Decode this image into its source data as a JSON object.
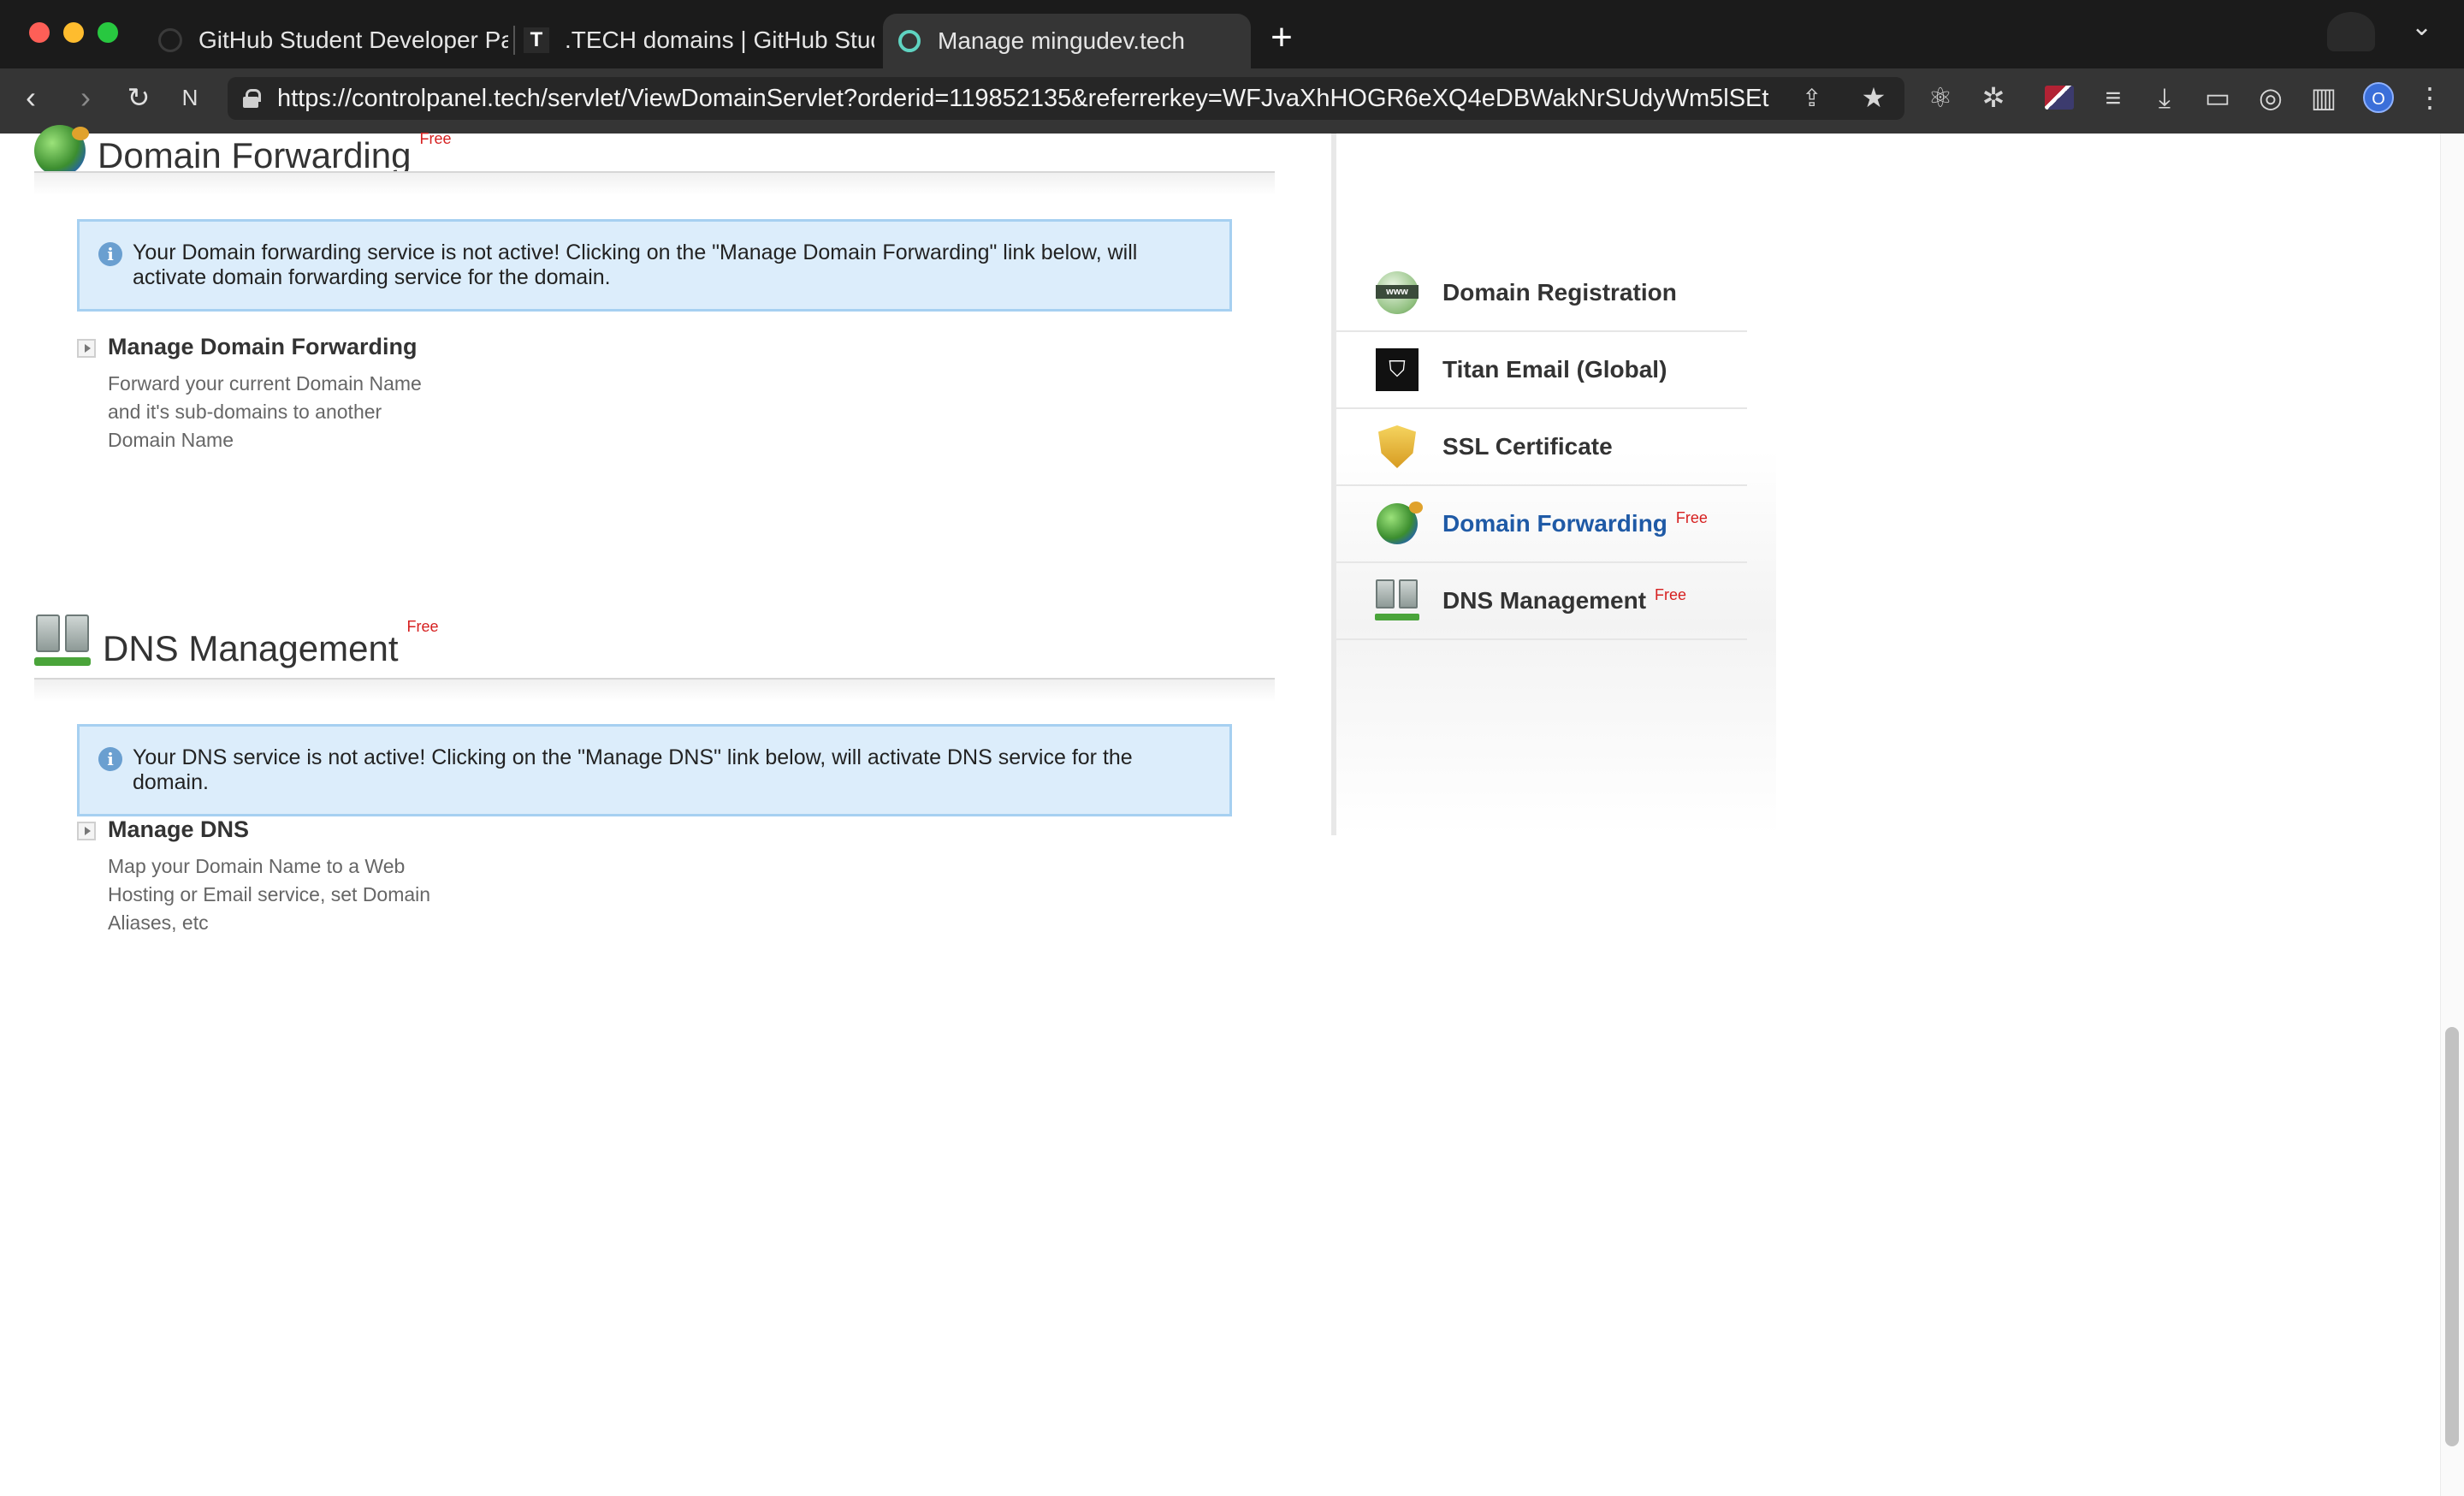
{
  "browser": {
    "tabs": [
      {
        "label": "GitHub Student Developer Pa",
        "icon": "github-icon"
      },
      {
        "label": ".TECH domains | GitHub Stud",
        "icon": "tech-icon"
      },
      {
        "label": "Manage mingudev.tech",
        "icon": "loading-icon"
      }
    ],
    "new_tab": "+",
    "url": "https://controlpanel.tech/servlet/ViewDomainServlet?orderid=119852135&referrerkey=WFJvaXhHOGR6eXQ4eDBWakNrSUdyWm5lSEt",
    "profile_initial": "O"
  },
  "forwarding": {
    "title": "Domain Forwarding",
    "free": "Free",
    "info": "Your Domain forwarding service is not active! Clicking on the \"Manage Domain Forwarding\" link below, will activate domain forwarding service for the domain.",
    "action_title": "Manage Domain Forwarding",
    "action_desc": "Forward your current Domain Name and it's sub-domains to another Domain Name"
  },
  "dns": {
    "title": "DNS Management",
    "free": "Free",
    "info": "Your DNS service is not active! Clicking on the \"Manage DNS\" link below, will activate DNS service for the domain.",
    "action_title": "Manage DNS",
    "action_desc": "Map your Domain Name to a Web Hosting or Email service, set Domain Aliases, etc"
  },
  "sidebar": {
    "items": [
      {
        "label": "Domain Registration",
        "icon": "www-globe-icon"
      },
      {
        "label": "Titan Email (Global)",
        "icon": "titan-icon"
      },
      {
        "label": "SSL Certificate",
        "icon": "shield-icon"
      },
      {
        "label": "Domain Forwarding",
        "free": "Free",
        "icon": "globe-icon",
        "active": true
      },
      {
        "label": "DNS Management",
        "free": "Free",
        "icon": "server-icon"
      }
    ]
  },
  "colors": {
    "accent_link": "#1f5aa6",
    "free_red": "#d62020",
    "info_bg": "#dcedfb",
    "info_border": "#a6d0f1"
  }
}
